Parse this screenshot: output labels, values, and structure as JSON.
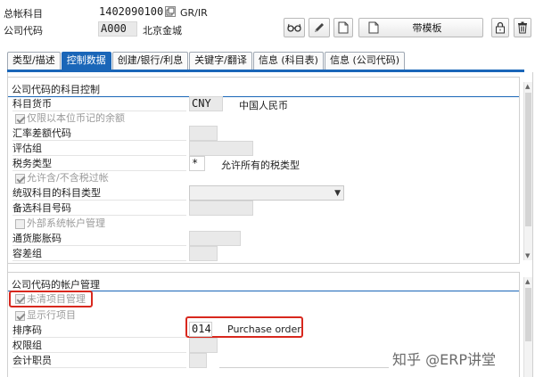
{
  "header": {
    "gl_account_label": "总帐科目",
    "gl_account_value": "1402090100",
    "gl_account_desc": "GR/IR",
    "company_code_label": "公司代码",
    "company_code_value": "A000",
    "company_code_desc": "北京金城",
    "template_button_label": "带模板"
  },
  "toolbar": {
    "icons": [
      "glasses-icon",
      "pencil-icon",
      "document-icon",
      "document-icon",
      "lock-icon",
      "trash-icon"
    ]
  },
  "tabs": [
    {
      "label": "类型/描述",
      "active": false
    },
    {
      "label": "控制数据",
      "active": true
    },
    {
      "label": "创建/银行/利息",
      "active": false
    },
    {
      "label": "关键字/翻译",
      "active": false
    },
    {
      "label": "信息 (科目表)",
      "active": false
    },
    {
      "label": "信息 (公司代码)",
      "active": false
    }
  ],
  "control_group": {
    "title": "公司代码的科目控制",
    "currency_label": "科目货币",
    "currency_value": "CNY",
    "currency_desc": "中国人民币",
    "local_currency_only_label": "仅限以本位币记的余额",
    "exchange_diff_label": "汇率差额代码",
    "valuation_group_label": "评估组",
    "tax_category_label": "税务类型",
    "tax_category_value": "*",
    "tax_category_desc": "允许所有的税类型",
    "posting_without_tax_label": "允许含/不含税过帐",
    "recon_type_label": "统驭科目的科目类型",
    "alt_account_label": "备选科目号码",
    "external_system_label": "外部系统帐户管理",
    "inflation_key_label": "通货膨胀码",
    "tolerance_group_label": "容差组"
  },
  "mgmt_group": {
    "title": "公司代码的帐户管理",
    "open_item_label": "未清项目管理",
    "line_item_label": "显示行项目",
    "sort_key_label": "排序码",
    "sort_key_value": "014",
    "sort_key_desc": "Purchase order",
    "auth_group_label": "权限组",
    "accounting_clerk_label": "会计职员"
  },
  "watermark": "知乎 @ERP讲堂"
}
